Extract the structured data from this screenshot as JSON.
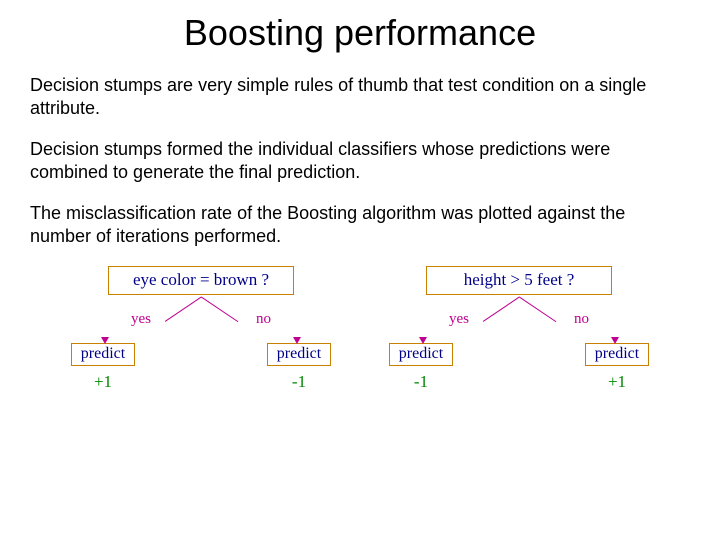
{
  "title": "Boosting performance",
  "paragraphs": {
    "p1": "Decision stumps are very simple rules of thumb that test condition on a single attribute.",
    "p2": "Decision stumps formed the individual classifiers whose predictions were combined to generate the final prediction.",
    "p3": "The misclassification rate of the Boosting algorithm was plotted against the number of iterations performed."
  },
  "labels": {
    "yes": "yes",
    "no": "no",
    "predict": "predict"
  },
  "stumps": [
    {
      "condition": "eye color = brown ?",
      "left_value": "+1",
      "right_value": "-1"
    },
    {
      "condition": "height > 5 feet ?",
      "left_value": "-1",
      "right_value": "+1"
    }
  ]
}
